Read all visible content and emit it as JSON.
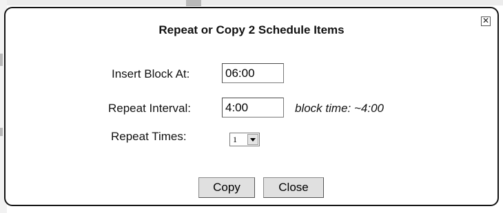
{
  "dialog": {
    "title": "Repeat or Copy 2 Schedule Items",
    "close_icon": "close-x-icon"
  },
  "form": {
    "insert_block": {
      "label": "Insert Block At:",
      "value": "06:00"
    },
    "repeat_interval": {
      "label": "Repeat Interval:",
      "value": "4:00",
      "note": "block time: ~4:00"
    },
    "repeat_times": {
      "label": "Repeat Times:",
      "selected": "1"
    }
  },
  "buttons": {
    "copy_label": "Copy",
    "close_label": "Close"
  }
}
